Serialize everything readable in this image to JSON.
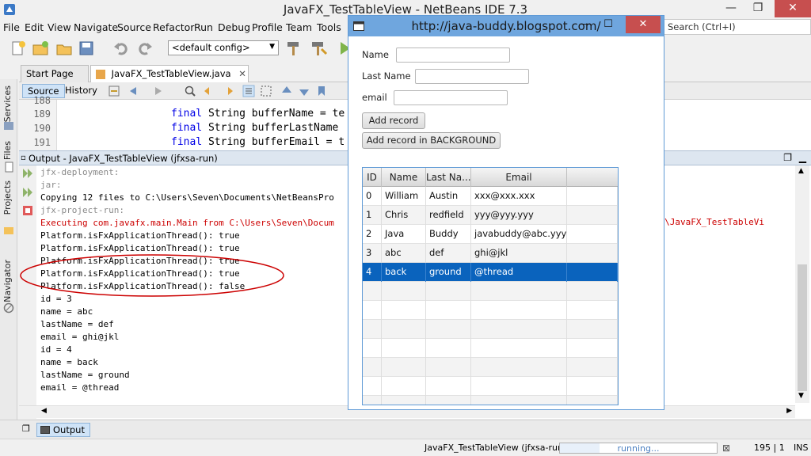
{
  "window": {
    "title": "JavaFX_TestTableView - NetBeans IDE 7.3",
    "minimize": "—",
    "maximize": "❐",
    "close": "✕"
  },
  "menu": [
    "File",
    "Edit",
    "View",
    "Navigate",
    "Source",
    "Refactor",
    "Run",
    "Debug",
    "Profile",
    "Team",
    "Tools"
  ],
  "search": {
    "placeholder": "Search (Ctrl+I)"
  },
  "toolbar": {
    "config": "<default config>"
  },
  "sidebar": {
    "items": [
      "Services",
      "Files",
      "Projects",
      "Navigator"
    ]
  },
  "editor": {
    "tabs": [
      "Start Page",
      "JavaFX_TestTableView.java"
    ],
    "subtabs": [
      "Source",
      "History"
    ],
    "lines": [
      {
        "num": "189",
        "kw": "final",
        "rest": " String bufferName = te"
      },
      {
        "num": "190",
        "kw": "final",
        "rest": " String bufferLastName"
      },
      {
        "num": "191",
        "kw": "final",
        "rest": " String bufferEmail = t"
      }
    ],
    "partial_line_num": "188"
  },
  "output": {
    "title": "Output - JavaFX_TestTableView (jfxsa-run)",
    "lines": [
      {
        "text": "jfx-deployment:",
        "style": "gray"
      },
      {
        "text": "jar:",
        "style": "gray"
      },
      {
        "text": "Copying 12 files to C:\\Users\\Seven\\Documents\\NetBeansPro",
        "style": "normal"
      },
      {
        "text": "jfx-project-run:",
        "style": "gray"
      },
      {
        "text": "Executing com.javafx.main.Main from C:\\Users\\Seven\\Docum",
        "style": "red"
      },
      {
        "text": "Platform.isFxApplicationThread(): true",
        "style": "normal"
      },
      {
        "text": "Platform.isFxApplicationThread(): true",
        "style": "normal"
      },
      {
        "text": "Platform.isFxApplicationThread(): true",
        "style": "normal"
      },
      {
        "text": "Platform.isFxApplicationThread(): true",
        "style": "normal"
      },
      {
        "text": "Platform.isFxApplicationThread(): false",
        "style": "normal"
      },
      {
        "text": "id = 3",
        "style": "normal"
      },
      {
        "text": "name = abc",
        "style": "normal"
      },
      {
        "text": "lastName = def",
        "style": "normal"
      },
      {
        "text": "email = ghi@jkl",
        "style": "normal"
      },
      {
        "text": "id = 4",
        "style": "normal"
      },
      {
        "text": "name = back",
        "style": "normal"
      },
      {
        "text": "lastName = ground",
        "style": "normal"
      },
      {
        "text": "email = @thread",
        "style": "normal"
      }
    ],
    "red_tail": "84016\\JavaFX_TestTableVi"
  },
  "bottom": {
    "output_tab": "Output"
  },
  "status": {
    "task": "JavaFX_TestTableView (jfxsa-run)",
    "progress_label": "running...",
    "progress_fraction": 0.25,
    "position": "195 | 1",
    "mode": "INS"
  },
  "fx": {
    "title": "http://java-buddy.blogspot.com/",
    "close": "✕",
    "maximize": "☐",
    "minimize": "—",
    "labels": {
      "name": "Name",
      "last_name": "Last Name",
      "email": "email"
    },
    "buttons": {
      "add": "Add record",
      "add_bg": "Add record in BACKGROUND"
    },
    "table": {
      "headers": [
        "ID",
        "Name",
        "Last Na...",
        "Email",
        ""
      ],
      "rows": [
        [
          "0",
          "William",
          "Austin",
          "xxx@xxx.xxx"
        ],
        [
          "1",
          "Chris",
          "redfield",
          "yyy@yyy.yyy"
        ],
        [
          "2",
          "Java",
          "Buddy",
          "javabuddy@abc.yyy"
        ],
        [
          "3",
          "abc",
          "def",
          "ghi@jkl"
        ],
        [
          "4",
          "back",
          "ground",
          "@thread"
        ]
      ],
      "selected_row": 4,
      "empty_rows": 7
    }
  },
  "colors": {
    "accent": "#0a63bd",
    "annotation": "#cc0000",
    "fx_titlebar": "#6fa6de",
    "close_button": "#c74f4f"
  }
}
